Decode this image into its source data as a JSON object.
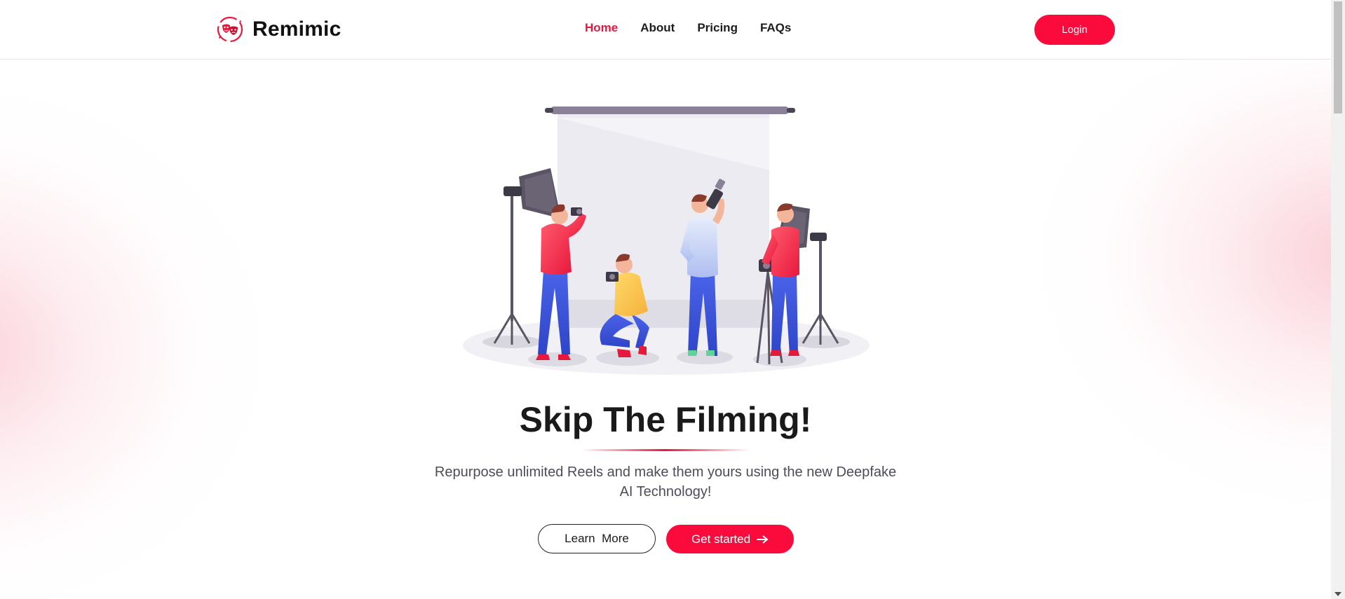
{
  "brand": {
    "name": "Remimic",
    "logo_icon": "theater-masks-icon",
    "accent_color": "#fb0a3c"
  },
  "nav": {
    "items": [
      {
        "label": "Home",
        "active": true
      },
      {
        "label": "About",
        "active": false
      },
      {
        "label": "Pricing",
        "active": false
      },
      {
        "label": "FAQs",
        "active": false
      }
    ],
    "active_color": "#e8183c"
  },
  "header": {
    "login_label": "Login"
  },
  "hero": {
    "illustration": "photo-studio-illustration",
    "title": "Skip The Filming!",
    "subtitle": "Repurpose unlimited Reels and make them yours using the new Deepfake AI Technology!",
    "learn_more_label": "Learn  More",
    "get_started_label": "Get started",
    "get_started_icon": "arrow-right-icon"
  }
}
